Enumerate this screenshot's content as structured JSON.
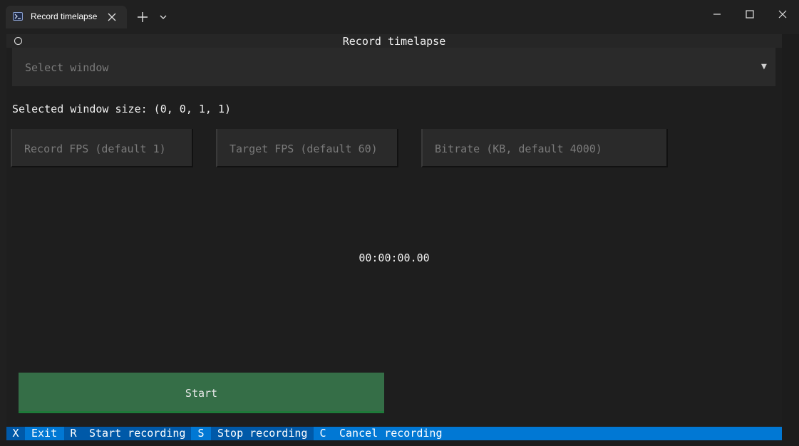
{
  "titlebar": {
    "tab_title": "Record timelapse",
    "tab_icon": "powershell-icon",
    "close_tab_icon": "close-icon",
    "new_tab_icon": "plus-icon",
    "dropdown_icon": "chevron-down-icon"
  },
  "window_controls": {
    "minimize_icon": "minimize-icon",
    "maximize_icon": "maximize-icon",
    "close_icon": "close-icon"
  },
  "app": {
    "title": "Record timelapse",
    "select": {
      "placeholder": "Select window",
      "arrow": "▼"
    },
    "window_size_text": "Selected window size: (0, 0, 1, 1)",
    "inputs": [
      {
        "placeholder": "Record FPS (default 1)"
      },
      {
        "placeholder": "Target FPS (default 60)"
      },
      {
        "placeholder": "Bitrate (KB, default 4000)"
      }
    ],
    "timer": "00:00:00.00",
    "start_label": "Start"
  },
  "footer": {
    "bindings": [
      {
        "key": "X",
        "label": "Exit"
      },
      {
        "key": "R",
        "label": "Start recording"
      },
      {
        "key": "S",
        "label": "Stop recording"
      },
      {
        "key": "C",
        "label": "Cancel recording"
      }
    ]
  },
  "colors": {
    "background": "#1e1e1e",
    "start_button": "#356e47",
    "footer": "#0178d4",
    "footer_key": "#0059a8"
  }
}
